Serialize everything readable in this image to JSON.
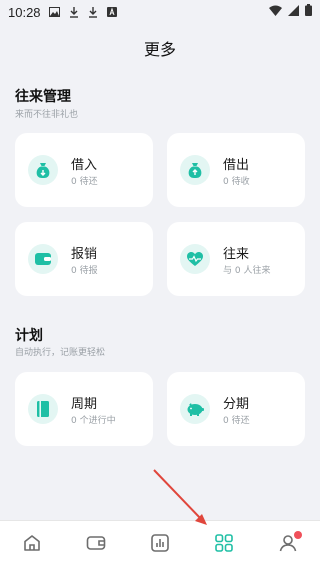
{
  "status_bar": {
    "time": "10:28"
  },
  "page_title": "更多",
  "sections": [
    {
      "title": "往来管理",
      "subtitle": "来而不往非礼也",
      "cards": [
        {
          "label": "借入",
          "sub": "0 待还",
          "icon": "money-bag-down-icon"
        },
        {
          "label": "借出",
          "sub": "0 待收",
          "icon": "money-bag-up-icon"
        },
        {
          "label": "报销",
          "sub": "0 待报",
          "icon": "wallet-icon"
        },
        {
          "label": "往来",
          "sub": "与 0 人往来",
          "icon": "heart-pulse-icon"
        }
      ]
    },
    {
      "title": "计划",
      "subtitle": "自动执行，记账更轻松",
      "cards": [
        {
          "label": "周期",
          "sub": "0 个进行中",
          "icon": "book-icon"
        },
        {
          "label": "分期",
          "sub": "0 待还",
          "icon": "piggy-bank-icon"
        }
      ]
    }
  ],
  "tabs": [
    {
      "name": "home",
      "icon": "home-icon"
    },
    {
      "name": "wallet",
      "icon": "wallet-icon"
    },
    {
      "name": "stats",
      "icon": "chart-icon"
    },
    {
      "name": "more",
      "icon": "grid-icon",
      "active": true
    },
    {
      "name": "profile",
      "icon": "user-icon",
      "badge": true
    }
  ],
  "colors": {
    "accent": "#1fbfa5",
    "icon_bg": "#e3f6f3",
    "tab_inactive": "#6d6d6d",
    "badge": "#f0505a"
  }
}
